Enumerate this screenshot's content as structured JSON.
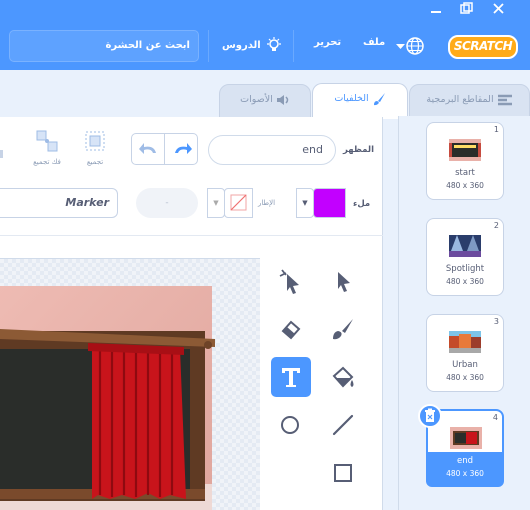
{
  "menubar": {
    "search_placeholder": "ابحث عن الحشرة",
    "tutorials": "الدروس",
    "edit": "تحرير",
    "file": "ملف",
    "logo": "SCRATCH"
  },
  "tabs": {
    "code": "المقاطع البرمجية",
    "backdrops": "الخلفيات",
    "sounds": "الأصوات"
  },
  "editor": {
    "costume_label": "المظهر",
    "costume_name": "end",
    "group": "تجميع",
    "ungroup": "فك تجميع",
    "fill_label": "ملء",
    "outline_label": "الإطار",
    "outline_width": "-",
    "font": "Marker"
  },
  "backdrops": [
    {
      "num": "1",
      "name": "start",
      "size": "480 x 360"
    },
    {
      "num": "2",
      "name": "Spotlight",
      "size": "480 x 360"
    },
    {
      "num": "3",
      "name": "Urban",
      "size": "480 x 360"
    },
    {
      "num": "4",
      "name": "end",
      "size": "480 x 360"
    }
  ],
  "colors": {
    "accent": "#4c97ff",
    "fill": "#c200ff",
    "logo": "#ffab19"
  },
  "tools": [
    "reshape-icon",
    "select-icon",
    "eraser-icon",
    "brush-icon",
    "text-icon",
    "fill-icon",
    "circle-icon",
    "line-icon",
    "rectangle-icon"
  ]
}
